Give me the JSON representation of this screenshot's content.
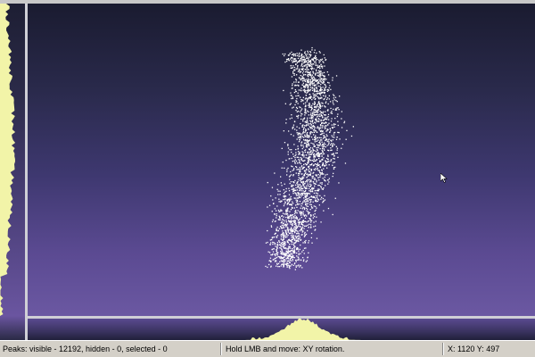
{
  "app": {
    "accent_color": "#f2f4a8",
    "point_color": "#ffffff"
  },
  "main_view": {
    "cursor_icon": "mouse-pointer-icon"
  },
  "status": {
    "peaks": "Peaks: visible - 12192, hidden - 0, selected - 0",
    "hint": "Hold LMB and move: XY rotation.",
    "coords": "X: 1120  Y: 497"
  }
}
